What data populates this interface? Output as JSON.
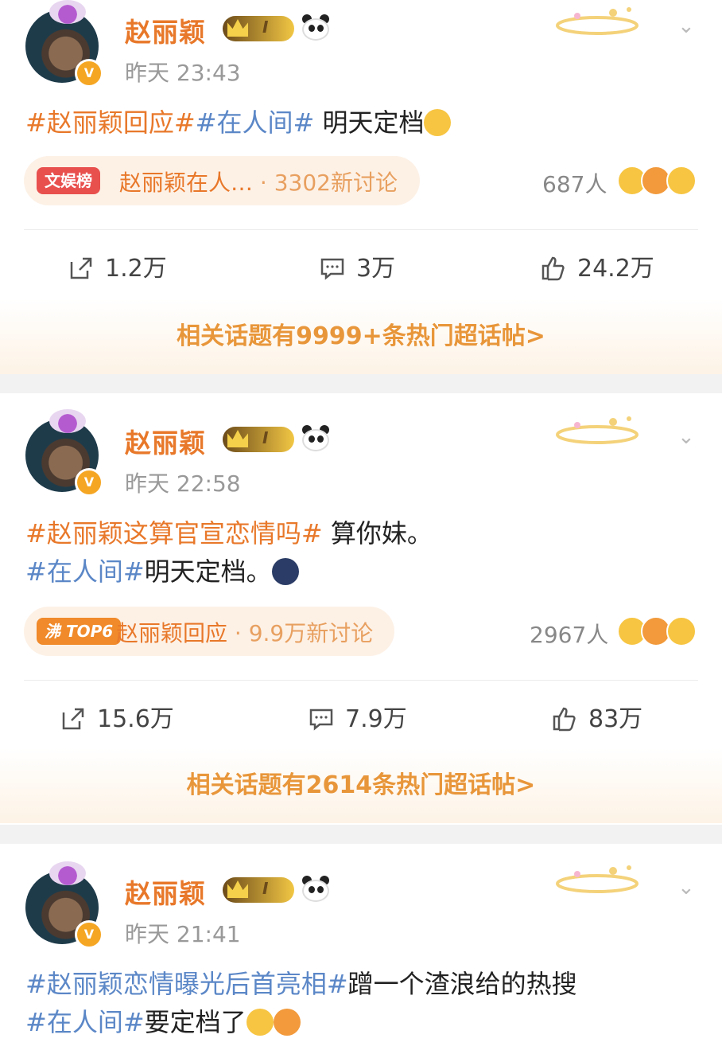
{
  "posts": [
    {
      "author": "赵丽颖",
      "level": "I",
      "time": "昨天 23:43",
      "line1": {
        "tag1": "#赵丽颖回应#",
        "tag2": "#在人间#",
        "text": " 明天定档"
      },
      "topic": {
        "badge": "文娱榜",
        "text": "赵丽颖在人…",
        "discuss": " · 3302新讨论"
      },
      "people": "687人",
      "repost": "1.2万",
      "comment": "3万",
      "like": "24.2万",
      "hot_topics": "相关话题有9999+条热门超话帖>"
    },
    {
      "author": "赵丽颖",
      "level": "I",
      "time": "昨天 22:58",
      "line1": {
        "tag1": "#赵丽颖这算官宣恋情吗#",
        "text": " 算你妹。"
      },
      "line2": {
        "tag1": "#在人间#",
        "text": "明天定档。"
      },
      "topic": {
        "badge": "沸 TOP6",
        "text": "赵丽颖回应",
        "discuss": " · 9.9万新讨论"
      },
      "people": "2967人",
      "repost": "15.6万",
      "comment": "7.9万",
      "like": "83万",
      "hot_topics": "相关话题有2614条热门超话帖>"
    },
    {
      "author": "赵丽颖",
      "level": "I",
      "time": "昨天 21:41",
      "line1": {
        "tag1": "#赵丽颖恋情曝光后首亮相#",
        "text": "蹭一个渣浪给的热搜"
      },
      "line2": {
        "tag1": "#在人间#",
        "text": "要定档了"
      }
    }
  ]
}
